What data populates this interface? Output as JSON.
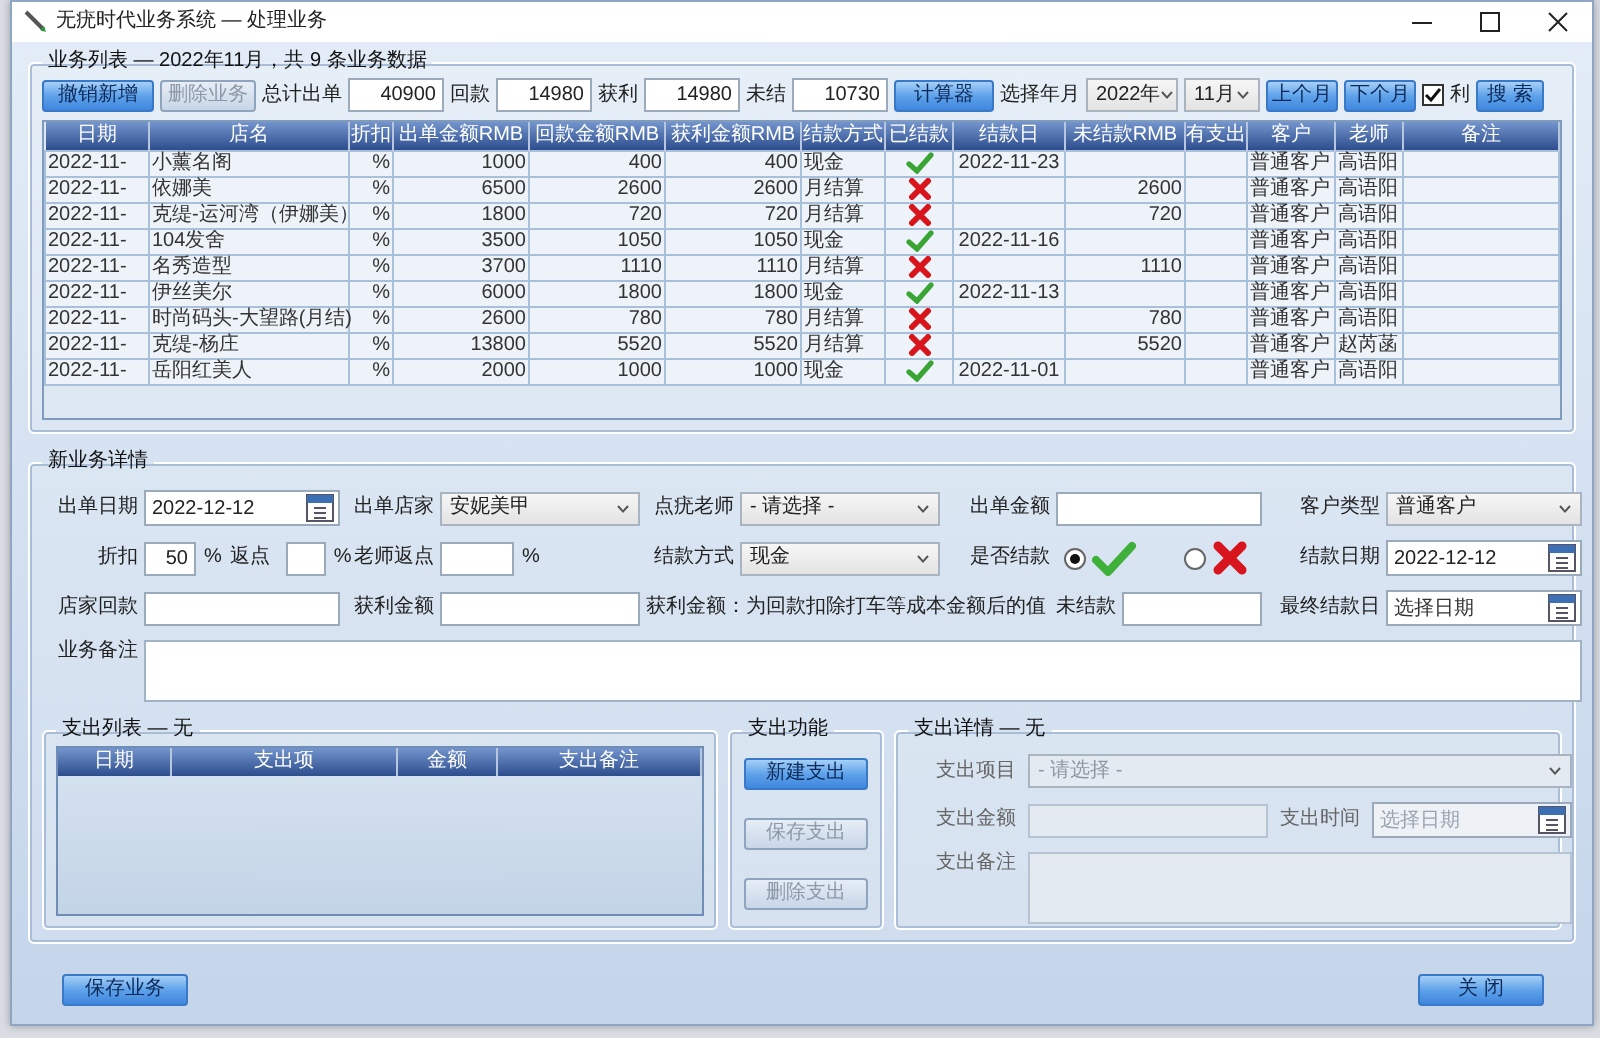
{
  "window": {
    "title": "无疣时代业务系统 — 处理业务"
  },
  "list": {
    "caption": "业务列表 — 2022年11月，共 9 条业务数据",
    "buttons": [
      {
        "label": "撤销新增",
        "disabled": false
      },
      {
        "label": "删除业务",
        "disabled": true
      }
    ],
    "totals": [
      {
        "label": "总计出单",
        "value": "40900"
      },
      {
        "label": "回款",
        "value": "14980"
      },
      {
        "label": "获利",
        "value": "14980"
      },
      {
        "label": "未结",
        "value": "10730"
      }
    ],
    "calc_button": "计算器",
    "period_label": "选择年月",
    "year": "2022年",
    "month": "11月",
    "prev_button": "上个月",
    "next_button": "下个月",
    "profit_checkbox": {
      "label": "利",
      "checked": true
    },
    "search_button": "搜 索"
  },
  "table": {
    "columns": [
      "日期",
      "店名",
      "折扣",
      "出单金额RMB",
      "回款金额RMB",
      "获利金额RMB",
      "结款方式",
      "已结款",
      "结款日",
      "未结款RMB",
      "有支出",
      "客户",
      "老师",
      "备注"
    ],
    "rows": [
      {
        "date": "2022-11-",
        "shop": "小薰名阁",
        "discount": "%",
        "amount": "1000",
        "refund": "400",
        "profit": "400",
        "method": "现金",
        "paid": true,
        "settled_on": "2022-11-23",
        "customer": "普通客户",
        "teacher": "高语阳"
      },
      {
        "date": "2022-11-",
        "shop": "依娜美",
        "discount": "%",
        "amount": "6500",
        "refund": "2600",
        "profit": "2600",
        "method": "月结算",
        "paid": false,
        "unpaid": "2600",
        "customer": "普通客户",
        "teacher": "高语阳"
      },
      {
        "date": "2022-11-",
        "shop": "克缇-运河湾（伊娜美）",
        "discount": "%",
        "amount": "1800",
        "refund": "720",
        "profit": "720",
        "method": "月结算",
        "paid": false,
        "unpaid": "720",
        "customer": "普通客户",
        "teacher": "高语阳"
      },
      {
        "date": "2022-11-",
        "shop": "104发舍",
        "discount": "%",
        "amount": "3500",
        "refund": "1050",
        "profit": "1050",
        "method": "现金",
        "paid": true,
        "settled_on": "2022-11-16",
        "customer": "普通客户",
        "teacher": "高语阳"
      },
      {
        "date": "2022-11-",
        "shop": "名秀造型",
        "discount": "%",
        "amount": "3700",
        "refund": "1110",
        "profit": "1110",
        "method": "月结算",
        "paid": false,
        "unpaid": "1110",
        "customer": "普通客户",
        "teacher": "高语阳"
      },
      {
        "date": "2022-11-",
        "shop": "伊丝美尔",
        "discount": "%",
        "amount": "6000",
        "refund": "1800",
        "profit": "1800",
        "method": "现金",
        "paid": true,
        "settled_on": "2022-11-13",
        "customer": "普通客户",
        "teacher": "高语阳"
      },
      {
        "date": "2022-11-",
        "shop": "时尚码头-大望路(月结)",
        "discount": "%",
        "amount": "2600",
        "refund": "780",
        "profit": "780",
        "method": "月结算",
        "paid": false,
        "unpaid": "780",
        "customer": "普通客户",
        "teacher": "高语阳"
      },
      {
        "date": "2022-11-",
        "shop": "克缇-杨庄",
        "discount": "%",
        "amount": "13800",
        "refund": "5520",
        "profit": "5520",
        "method": "月结算",
        "paid": false,
        "unpaid": "5520",
        "customer": "普通客户",
        "teacher": "赵芮菡"
      },
      {
        "date": "2022-11-",
        "shop": "岳阳红美人",
        "discount": "%",
        "amount": "2000",
        "refund": "1000",
        "profit": "1000",
        "method": "现金",
        "paid": true,
        "settled_on": "2022-11-01",
        "customer": "普通客户",
        "teacher": "高语阳"
      }
    ]
  },
  "detail": {
    "caption": "新业务详情",
    "order_date": {
      "label": "出单日期",
      "value": "2022-12-12"
    },
    "shop": {
      "label": "出单店家",
      "value": "安妮美甲"
    },
    "teacher": {
      "label": "点疣老师",
      "value": "- 请选择 -"
    },
    "amount": {
      "label": "出单金额"
    },
    "customer_type": {
      "label": "客户类型",
      "value": "普通客户"
    },
    "discount": {
      "label": "折扣",
      "value": "50",
      "unit": "%"
    },
    "rebate": {
      "label": "返点",
      "unit": "%"
    },
    "teacher_rebate": {
      "label": "老师返点",
      "unit": "%"
    },
    "pay_method": {
      "label": "结款方式",
      "value": "现金"
    },
    "settled": {
      "label": "是否结款",
      "options": [
        {
          "kind": "yes",
          "selected": true
        },
        {
          "kind": "no",
          "selected": false
        }
      ]
    },
    "settle_date": {
      "label": "结款日期",
      "value": "2022-12-12"
    },
    "shop_refund": {
      "label": "店家回款"
    },
    "profit": {
      "label": "获利金额"
    },
    "profit_note": "获利金额：为回款扣除打车等成本金额后的值",
    "unpaid": {
      "label": "未结款"
    },
    "final_date": {
      "label": "最终结款日",
      "placeholder": "选择日期"
    },
    "remark": {
      "label": "业务备注"
    }
  },
  "expenses": {
    "caption": "支出列表 — 无",
    "columns": [
      "日期",
      "支出项",
      "金额",
      "支出备注"
    ]
  },
  "expense_actions": {
    "caption": "支出功能",
    "buttons": [
      {
        "label": "新建支出",
        "disabled": false
      },
      {
        "label": "保存支出",
        "disabled": true
      },
      {
        "label": "删除支出",
        "disabled": true
      }
    ]
  },
  "expense_detail": {
    "caption": "支出详情 — 无",
    "disabled": true,
    "item": {
      "label": "支出项目",
      "value": "- 请选择 -"
    },
    "amount": {
      "label": "支出金额"
    },
    "time": {
      "label": "支出时间",
      "placeholder": "选择日期"
    },
    "note": {
      "label": "支出备注"
    }
  },
  "footer": {
    "save_button": "保存业务",
    "close_button": "关 闭"
  }
}
